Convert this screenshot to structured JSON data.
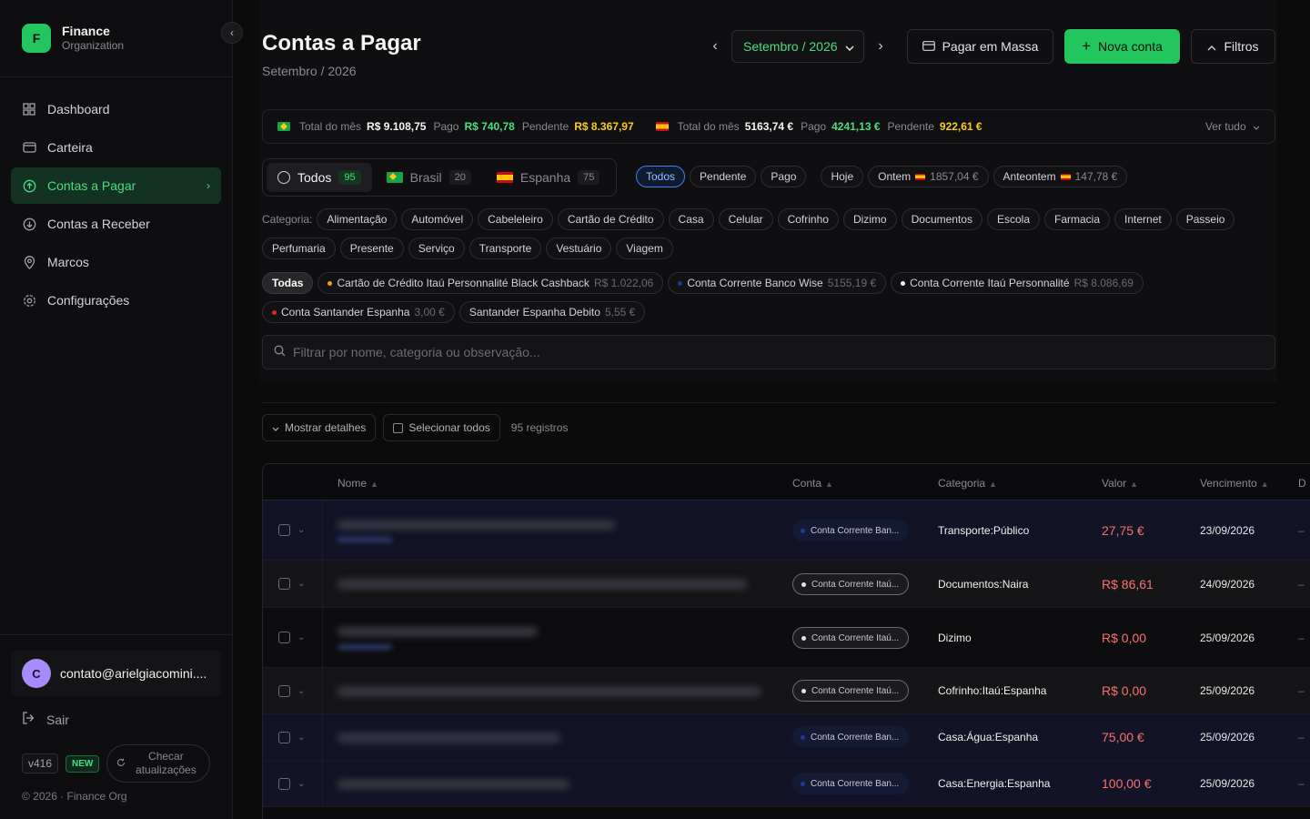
{
  "sidebar": {
    "brand": {
      "logo_letter": "F",
      "name": "Finance",
      "subtitle": "Organization"
    },
    "items": [
      {
        "label": "Dashboard",
        "icon": "grid-icon"
      },
      {
        "label": "Carteira",
        "icon": "wallet-icon"
      },
      {
        "label": "Contas a Pagar",
        "icon": "arrow-up-circle-icon",
        "active": true
      },
      {
        "label": "Contas a Receber",
        "icon": "arrow-down-circle-icon"
      },
      {
        "label": "Marcos",
        "icon": "pin-icon"
      },
      {
        "label": "Configurações",
        "icon": "gear-icon"
      }
    ],
    "user": {
      "initial": "C",
      "email": "contato@arielgiacomini...."
    },
    "logout_label": "Sair",
    "version": "v416",
    "new_badge": "NEW",
    "check_updates": "Checar atualizações",
    "copyright": "© 2026 · Finance Org"
  },
  "header": {
    "title": "Contas a Pagar",
    "subtitle": "Setembro / 2026",
    "month_select": "Setembro / 2026",
    "pay_bulk": "Pagar em Massa",
    "new_account": "Nova conta",
    "filters": "Filtros"
  },
  "summary": {
    "br": {
      "total_label": "Total do mês",
      "total": "R$ 9.108,75",
      "paid_label": "Pago",
      "paid": "R$ 740,78",
      "pending_label": "Pendente",
      "pending": "R$ 8.367,97"
    },
    "es": {
      "total_label": "Total do mês",
      "total": "5163,74 €",
      "paid_label": "Pago",
      "paid": "4241,13 €",
      "pending_label": "Pendente",
      "pending": "922,61 €"
    },
    "see_all": "Ver tudo"
  },
  "country_tabs": [
    {
      "label": "Todos",
      "count": "95"
    },
    {
      "label": "Brasil",
      "count": "20"
    },
    {
      "label": "Espanha",
      "count": "75"
    }
  ],
  "status_filters": [
    "Todos",
    "Pendente",
    "Pago"
  ],
  "day_filters": {
    "today": "Hoje",
    "yesterday": "Ontem",
    "yesterday_value": "1857,04 €",
    "before": "Anteontem",
    "before_value": "147,78 €"
  },
  "categories": {
    "label": "Categoria:",
    "items": [
      "Alimentação",
      "Automóvel",
      "Cabeleleiro",
      "Cartão de Crédito",
      "Casa",
      "Celular",
      "Cofrinho",
      "Dizimo",
      "Documentos",
      "Escola",
      "Farmacia",
      "Internet",
      "Passeio",
      "Perfumaria",
      "Presente",
      "Serviço",
      "Transporte",
      "Vestuário",
      "Viagem"
    ]
  },
  "accounts": {
    "all": "Todas",
    "items": [
      {
        "name": "Cartão de Crédito Itaú Personnalité Black Cashback",
        "amount": "R$ 1.022,06",
        "color": "#f59e0b"
      },
      {
        "name": "Conta Corrente Banco Wise",
        "amount": "5155,19 €",
        "color": "#1e3a8a"
      },
      {
        "name": "Conta Corrente Itaú Personnalité",
        "amount": "R$ 8.086,69",
        "color": "#f5f5f5"
      },
      {
        "name": "Conta Santander Espanha",
        "amount": "3,00 €",
        "color": "#dc2626"
      },
      {
        "name": "Santander Espanha Debito",
        "amount": "5,55 €",
        "color": ""
      }
    ]
  },
  "search": {
    "placeholder": "Filtrar por nome, categoria ou observação..."
  },
  "toolbar": {
    "show_details": "Mostrar detalhes",
    "select_all": "Selecionar todos",
    "records": "95 registros"
  },
  "table": {
    "columns": [
      "Nome",
      "Conta",
      "Categoria",
      "Valor",
      "Vencimento",
      "D"
    ],
    "rows": [
      {
        "account": "Conta Corrente Ban...",
        "account_style": "blue",
        "category": "Transporte:Público",
        "value": "27,75 €",
        "due": "23/09/2026",
        "extra": "–"
      },
      {
        "account": "Conta Corrente Itaú...",
        "account_style": "gray",
        "category": "Documentos:Naira",
        "value": "R$ 86,61",
        "due": "24/09/2026",
        "extra": "–"
      },
      {
        "account": "Conta Corrente Itaú...",
        "account_style": "gray",
        "category": "Dizimo",
        "value": "R$ 0,00",
        "due": "25/09/2026",
        "extra": "–"
      },
      {
        "account": "Conta Corrente Itaú...",
        "account_style": "gray",
        "category": "Cofrinho:Itaú:Espanha",
        "value": "R$ 0,00",
        "due": "25/09/2026",
        "extra": "–"
      },
      {
        "account": "Conta Corrente Ban...",
        "account_style": "blue",
        "category": "Casa:Água:Espanha",
        "value": "75,00 €",
        "due": "25/09/2026",
        "extra": "–"
      },
      {
        "account": "Conta Corrente Ban...",
        "account_style": "blue",
        "category": "Casa:Energia:Espanha",
        "value": "100,00 €",
        "due": "25/09/2026",
        "extra": "–"
      }
    ]
  },
  "colors": {
    "accent": "#22c55e",
    "danger": "#f87171",
    "pending": "#facc15",
    "bg": "#0b0b0c"
  }
}
